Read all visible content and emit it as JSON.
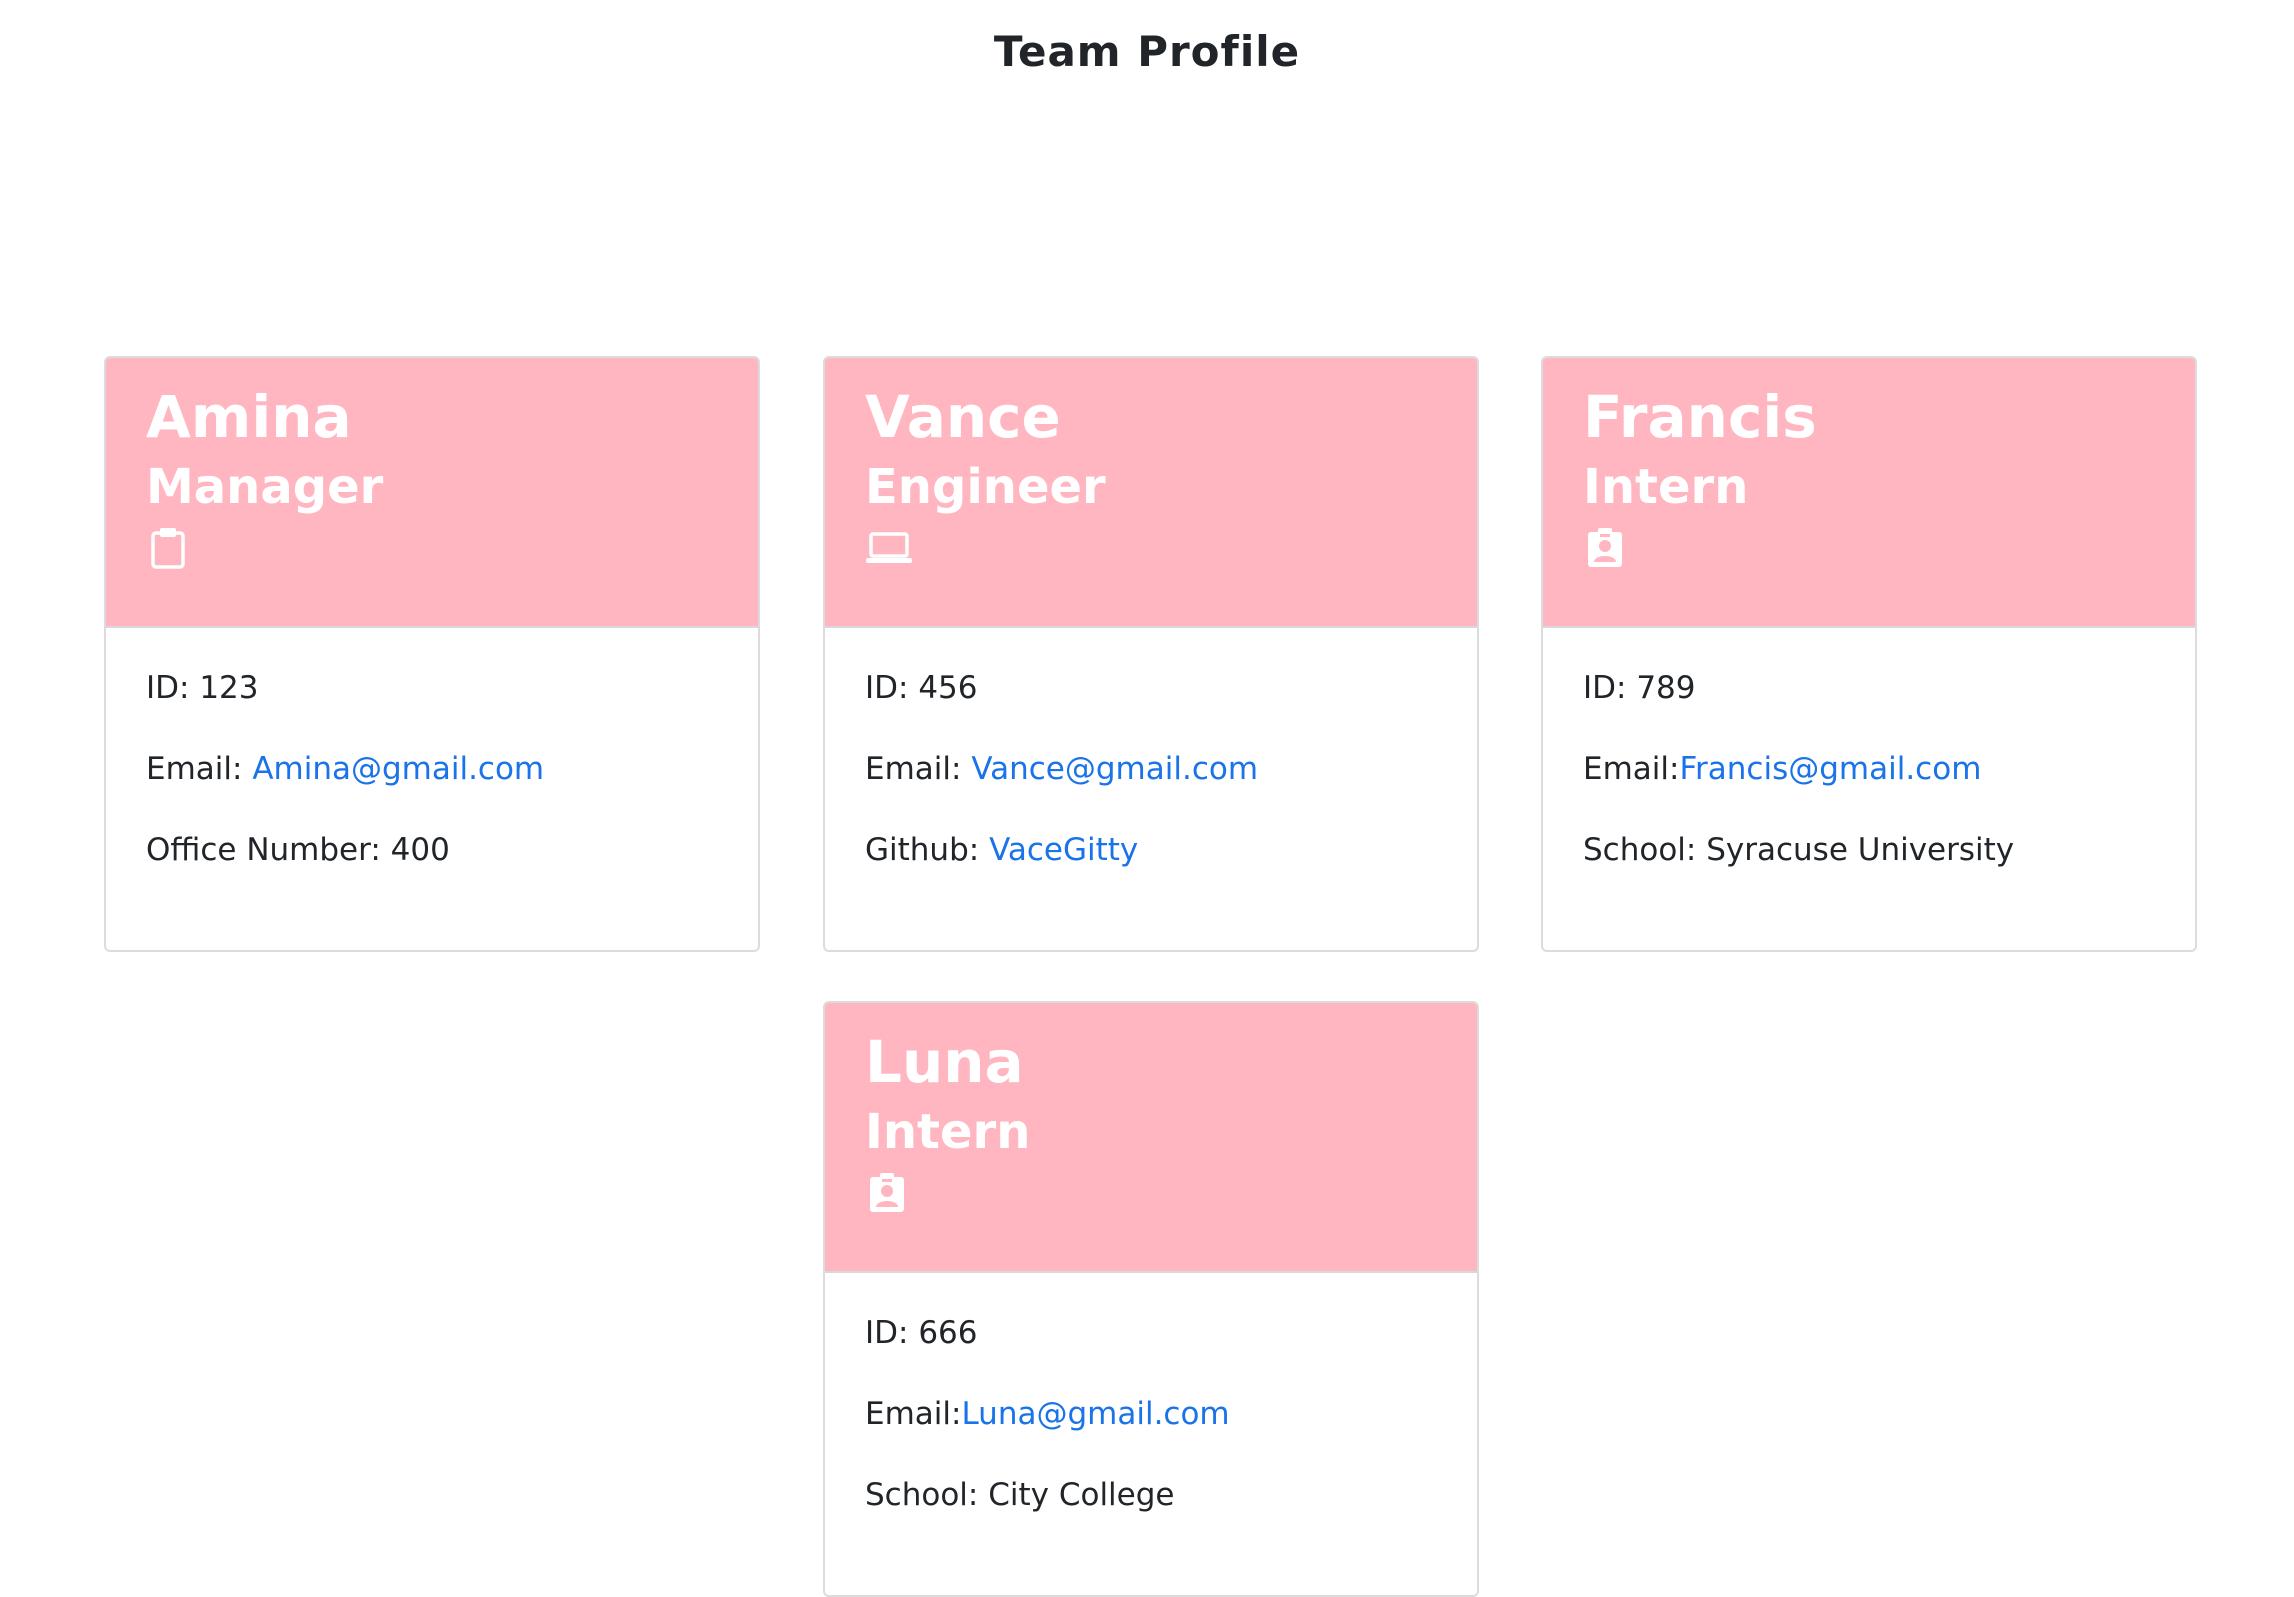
{
  "page": {
    "title": "Team Profile"
  },
  "colors": {
    "header_bg": "#ffb6c1",
    "link": "#1a73e8",
    "text": "#212529"
  },
  "cards": [
    {
      "name": "Amina",
      "role": "Manager",
      "icon": "clipboard-icon",
      "id_label": "ID: ",
      "id_value": "123",
      "email_label": "Email: ",
      "email": "Amina@gmail.com",
      "extra_label": "Office Number: ",
      "extra_value": "400"
    },
    {
      "name": "Vance",
      "role": "Engineer",
      "icon": "laptop-icon",
      "id_label": "ID: ",
      "id_value": "456",
      "email_label": "Email: ",
      "email": "Vance@gmail.com",
      "extra_label": "Github: ",
      "extra_value": "VaceGitty"
    },
    {
      "name": "Francis",
      "role": "Intern",
      "icon": "id-badge-icon",
      "id_label": "ID: ",
      "id_value": "789",
      "email_label": "Email:",
      "email": "Francis@gmail.com",
      "extra_label": "School: ",
      "extra_value": "Syracuse University"
    },
    {
      "name": "Luna",
      "role": "Intern",
      "icon": "id-badge-icon",
      "id_label": "ID: ",
      "id_value": "666",
      "email_label": "Email:",
      "email": "Luna@gmail.com",
      "extra_label": "School: ",
      "extra_value": "City College"
    }
  ]
}
